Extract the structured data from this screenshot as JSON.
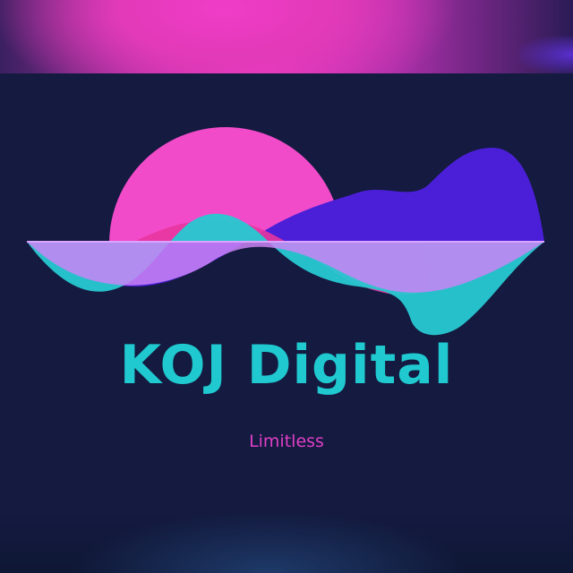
{
  "brand": {
    "name": "KOJ Digital",
    "tagline": "Limitless"
  },
  "colors": {
    "background": "#141a40",
    "sun": "#f24bc9",
    "wave_purple": "#4b1fd8",
    "wave_cyan": "#27c9d2",
    "wave_lavender": "#c984f5",
    "wave_pink": "#e8359f",
    "brand_text": "#1fc9cf",
    "tagline_text": "#e03fc6"
  },
  "icons": [
    "sun-wave-logo-icon"
  ]
}
